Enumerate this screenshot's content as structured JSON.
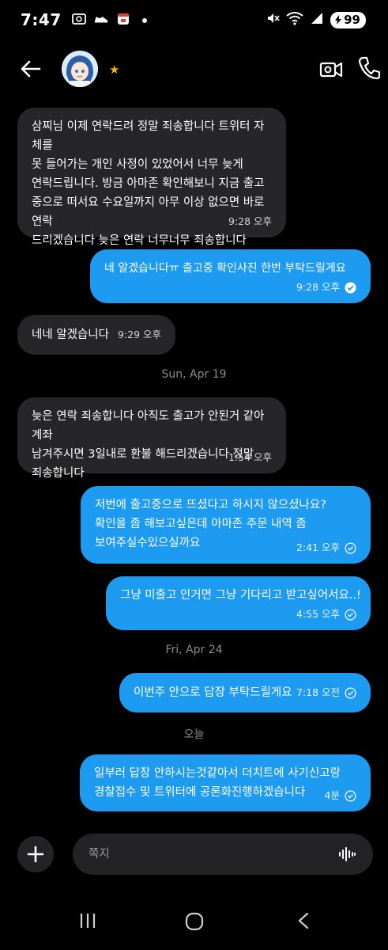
{
  "status_bar": {
    "time": "7:47",
    "battery": "99",
    "icons": [
      "gallery-icon",
      "sneaker-icon",
      "calendar-icon",
      "mute-icon",
      "wifi-icon",
      "signal-icon",
      "battery-icon"
    ]
  },
  "header": {
    "back_icon": "arrow-left-icon",
    "avatar": "anime-avatar",
    "badge": "★",
    "video_icon": "video-call-icon",
    "call_icon": "phone-icon"
  },
  "messages": [
    {
      "id": "m1",
      "dir": "in",
      "text": "삼찌님 이제 연락드려 정말 죄송합니다 트위터 자체를\n못 들어가는 개인 사정이 있었어서 너무 늦게\n연락드립니다. 방금 아마존 확인해보니 지금 출고\n중으로 떠서요 수요일까지 아무 이상 없으면 바로 연락\n드리겠습니다 늦은 연락 너무너무 죄송합니다",
      "time": "9:28 오후"
    },
    {
      "id": "m2",
      "dir": "out",
      "text": "네 알겠습니다ㅠ 출고중 확인사진 한번 부탁드릴게요",
      "time": "9:28 오후",
      "status": "read"
    },
    {
      "id": "m3",
      "dir": "in",
      "text": "네네 알겠습니다",
      "time": "9:29 오후"
    },
    {
      "id": "m4",
      "dir": "in",
      "text": "늦은 연락 죄송합니다 아직도 출고가 안된거 같아 계좌\n남겨주시면 3일내로  환불 해드리겠습니다 정말\n죄송합니다",
      "time": "1:54 오후"
    },
    {
      "id": "m5",
      "dir": "out",
      "text": "저번에 출고중으로 뜨셨다고 하시지 않으셨나요?\n확인을 좀 해보고싶은데 아마존 주문 내역 좀\n보여주실수있으실까요",
      "time": "2:41 오후",
      "status": "sent"
    },
    {
      "id": "m6",
      "dir": "out",
      "text": "그냥 미출고 인거면 그냥 기다리고 받고싶어서요..!",
      "time": "4:55 오후",
      "status": "sent"
    },
    {
      "id": "m7",
      "dir": "out",
      "text": "이번주 안으로 답장 부탁드릴게요",
      "time": "7:18 오전",
      "status": "sent"
    },
    {
      "id": "m8",
      "dir": "out",
      "text": "일부러 답장 안하시는것같아서 더치트에 사기신고랑\n경찰접수 및 트위터에 공론화진행하겠습니다",
      "time": "4분",
      "status": "sent"
    }
  ],
  "date_separators": [
    "Sun, Apr 19",
    "Fri, Apr 24",
    "오늘"
  ],
  "composer": {
    "placeholder": "쪽지",
    "plus_icon": "plus-icon",
    "voice_icon": "voice-wave-icon"
  },
  "navbar": {
    "icons": [
      "recent-apps-icon",
      "home-icon",
      "back-icon"
    ]
  }
}
